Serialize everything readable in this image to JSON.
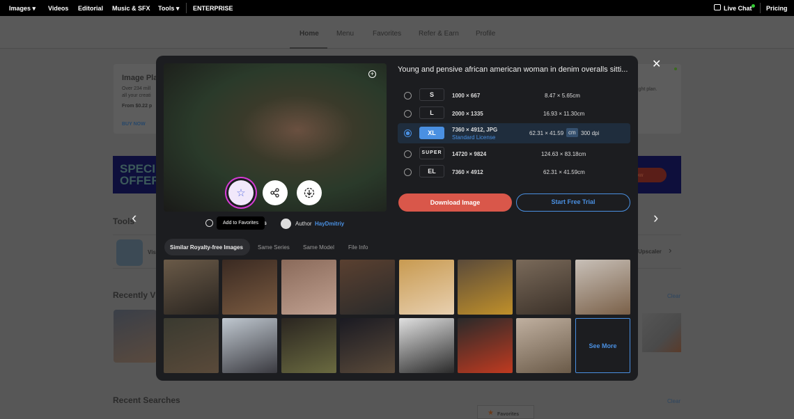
{
  "topbar": {
    "images": "Images ▾",
    "videos": "Videos",
    "editorial": "Editorial",
    "music": "Music & SFX",
    "tools": "Tools ▾",
    "enterprise": "ENTERPRISE",
    "live_chat": "Live Chat",
    "pricing": "Pricing"
  },
  "subnav": {
    "items": [
      "Home",
      "Menu",
      "Favorites",
      "Refer & Earn",
      "Profile"
    ]
  },
  "background": {
    "plan_title": "Image Pla",
    "plan_line1": "Over 234 mill",
    "plan_line2": "all your creati",
    "plan_price": "From $0.22 p",
    "plan_right": "ight plan.",
    "buy_now": "BUY NOW",
    "offer": "SPECI\nOFFER",
    "offer_btn": "y Now",
    "tools": "Tools",
    "tools_item": "Vis",
    "upscaler": "Upscaler",
    "recently_viewed": "Recently V",
    "clear": "Clear",
    "recent_searches": "Recent Searches",
    "favorites": "Favorites"
  },
  "modal": {
    "title": "Young and pensive african american woman in denim overalls sitti...",
    "sizes": [
      {
        "label": "S",
        "pixels": "1000 × 667",
        "print": "8.47 × 5.65cm",
        "selected": false
      },
      {
        "label": "L",
        "pixels": "2000 × 1335",
        "print": "16.93 × 11.30cm",
        "selected": false
      },
      {
        "label": "XL",
        "pixels": "7360 × 4912, JPG",
        "license": "Standard License",
        "print": "62.31 × 41.59",
        "unit": "cm",
        "dpi": "300 dpi",
        "selected": true
      },
      {
        "label": "SUPER",
        "pixels": "14720 × 9824",
        "print": "124.63 × 83.18cm",
        "selected": false
      },
      {
        "label": "EL",
        "pixels": "7360 × 4912",
        "print": "62.31 × 41.59cm",
        "selected": false
      }
    ],
    "download": "Download Image",
    "trial": "Start Free Trial",
    "tooltip": "Add to Favorites",
    "search_label": "es",
    "author_label": "Author",
    "author": "HayDmitriy",
    "tabs": [
      "Similar Royalty-free Images",
      "Same Series",
      "Same Model",
      "File Info"
    ],
    "see_more": "See More",
    "colors": {
      "accent": "#4a90e2",
      "download": "#d9574a",
      "favorite_ring": "#d63bd6"
    }
  }
}
